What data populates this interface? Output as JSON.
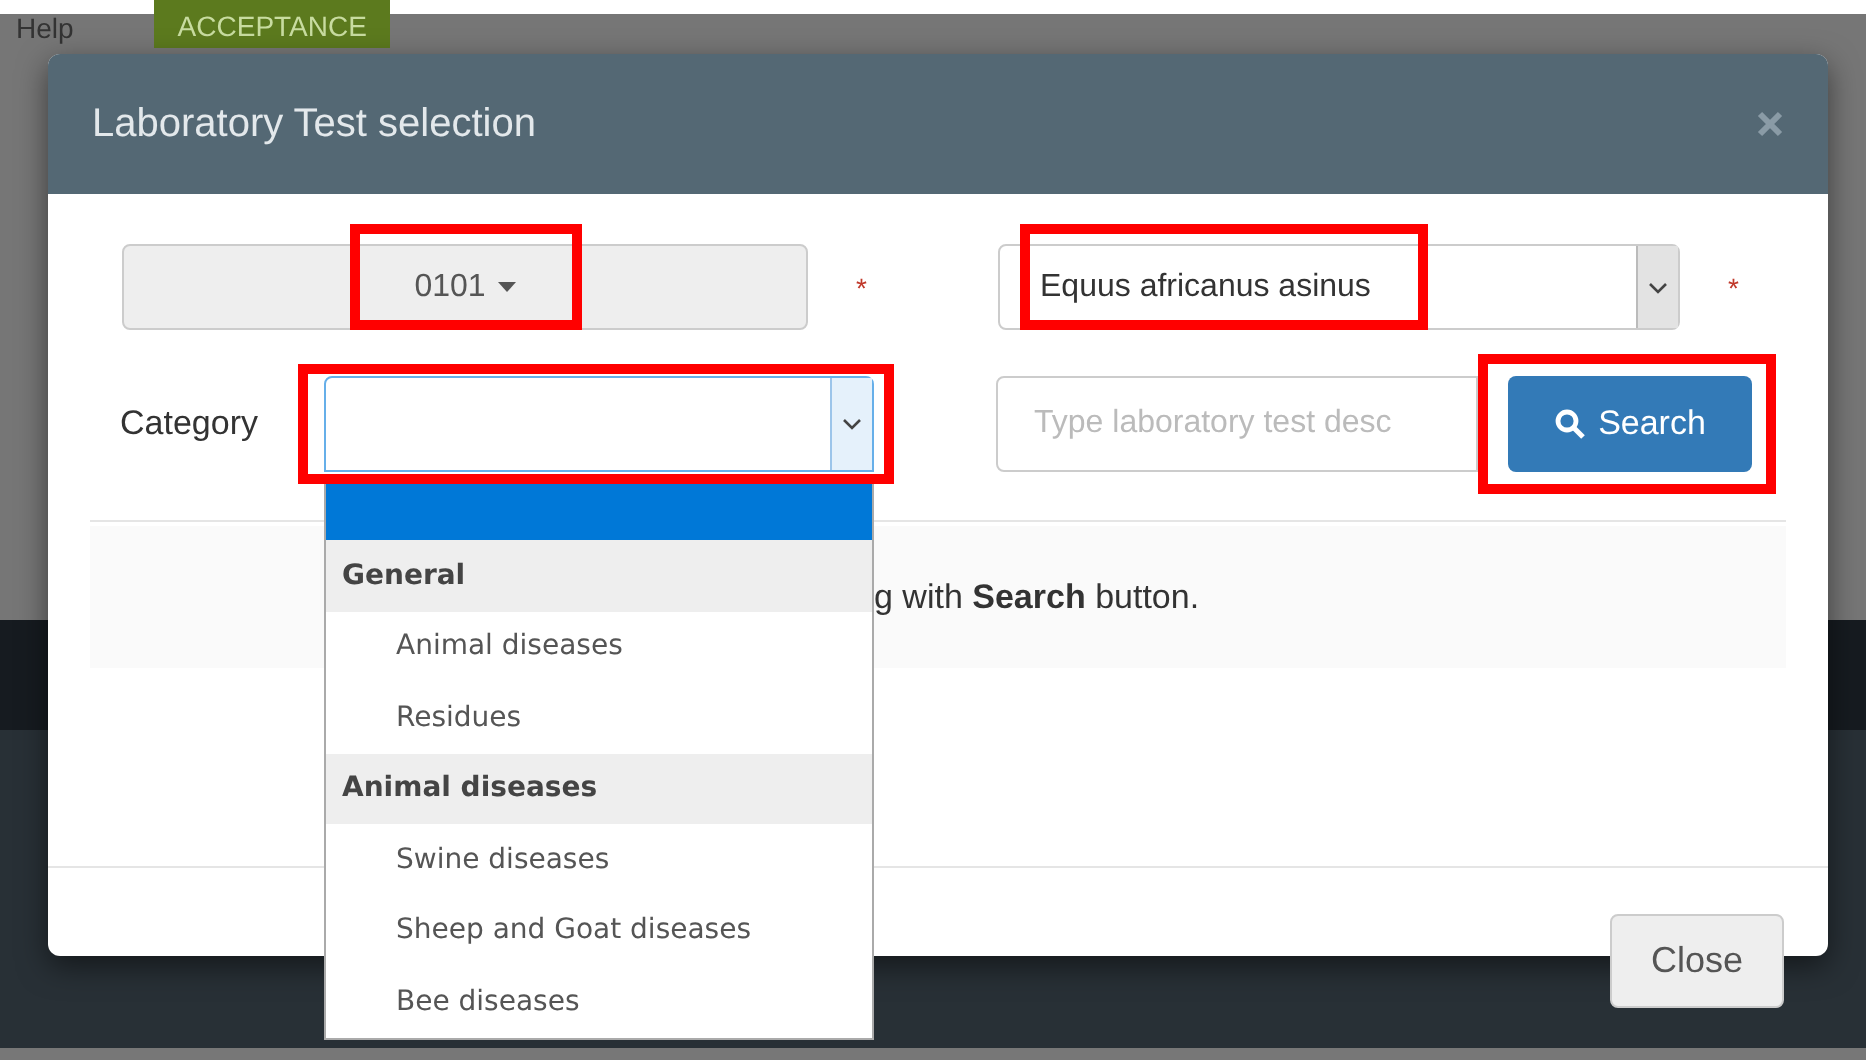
{
  "top_bar": {
    "help": "Help",
    "badge": "ACCEPTANCE"
  },
  "dialog": {
    "title": "Laboratory Test selection",
    "code_button": {
      "value": "0101",
      "highlighted": true
    },
    "code_required": "*",
    "species_select": {
      "value": "Equus africanus asinus",
      "highlighted": true
    },
    "species_required": "*",
    "category_label": "Category",
    "category_select": {
      "highlighted": true,
      "expanded": true,
      "options": [
        {
          "kind": "blank",
          "selected": true
        },
        {
          "kind": "group",
          "label": "General",
          "selected": false
        },
        {
          "kind": "option",
          "label": "Animal diseases",
          "selected": false
        },
        {
          "kind": "option",
          "label": "Residues",
          "selected": false
        },
        {
          "kind": "group",
          "label": "Animal diseases",
          "selected": false
        },
        {
          "kind": "option",
          "label": "Swine diseases",
          "selected": false
        },
        {
          "kind": "option",
          "label": "Sheep and Goat diseases",
          "selected": false
        },
        {
          "kind": "option",
          "label": "Bee diseases",
          "selected": false
        }
      ]
    },
    "search_field": {
      "placeholder": "Type laboratory test desc"
    },
    "search_button": {
      "label": "Search",
      "highlighted": true
    },
    "info_text": "g with **Search** button.",
    "close_button": "Close"
  }
}
